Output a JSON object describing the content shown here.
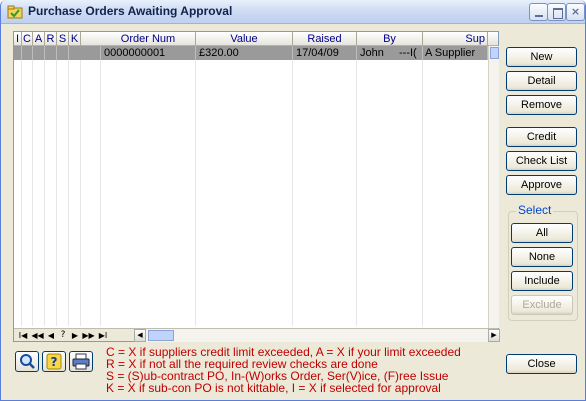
{
  "window": {
    "title": "Purchase Orders Awaiting Approval"
  },
  "titlebar_buttons": {
    "close_label": "×"
  },
  "grid": {
    "columns": [
      "I",
      "C",
      "A",
      "R",
      "S",
      "K",
      "Order Num",
      "Value",
      "Raised",
      "By",
      "Sup"
    ],
    "rows": [
      {
        "I": "",
        "C": "",
        "A": "",
        "R": "",
        "S": "",
        "K": "",
        "order_num": "0000000001",
        "value": "£320.00",
        "raised": "17/04/09",
        "by": "John",
        "by_extra": "---I(",
        "supplier": "A Supplier"
      }
    ]
  },
  "nav": {
    "first": "I◀",
    "prev_page": "◀◀",
    "prev": "◀",
    "unknown": "?",
    "next": "▶",
    "next_page": "▶▶",
    "last": "▶I"
  },
  "buttons": {
    "new": "New",
    "detail": "Detail",
    "remove": "Remove",
    "credit": "Credit",
    "check_list": "Check List",
    "approve": "Approve",
    "close": "Close"
  },
  "select": {
    "title": "Select",
    "all": "All",
    "none": "None",
    "include": "Include",
    "exclude": "Exclude"
  },
  "legend": [
    "C = X if suppliers credit limit exceeded, A = X if your limit exceeded",
    "R = X if not all the required review checks are done",
    "S = (S)ub-contract PO, In-(W)orks Order, Ser(V)ice, (F)ree Issue",
    "K = X if sub-con PO is not kittable, I = X if selected for approval"
  ],
  "icons": {
    "search": "search-icon",
    "help": "help-icon",
    "print": "printer-icon"
  },
  "colors": {
    "legend_text": "#c00000",
    "header_text": "#00008b",
    "selected_row": "#9a9a9a",
    "select_title": "#0046d5"
  }
}
